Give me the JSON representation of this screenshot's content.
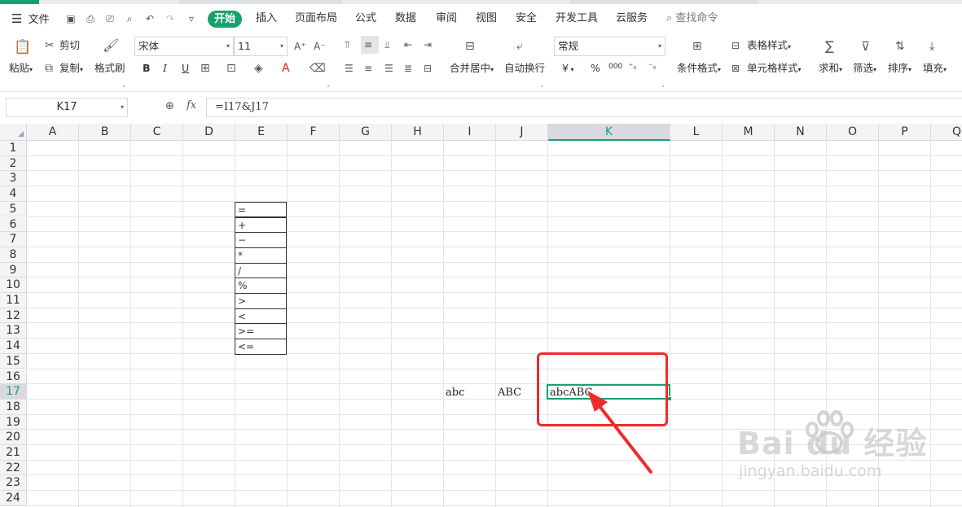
{
  "menu": {
    "file": "文件",
    "tabs": [
      "开始",
      "插入",
      "页面布局",
      "公式",
      "数据",
      "审阅",
      "视图",
      "安全",
      "开发工具",
      "云服务"
    ],
    "active_tab": "开始",
    "search": "查找命令"
  },
  "ribbon": {
    "paste": "粘贴",
    "cut": "剪切",
    "copy": "复制",
    "format_painter": "格式刷",
    "font_name": "宋体",
    "font_size": "11",
    "bold": "B",
    "italic": "I",
    "underline": "U",
    "merge_center": "合并居中",
    "wrap_text": "自动换行",
    "number_format": "常规",
    "currency": "¥",
    "percent": "%",
    "thousands": "000",
    "conditional_format": "条件格式",
    "table_style": "表格样式",
    "cell_style": "单元格样式",
    "sum": "求和",
    "filter": "筛选",
    "sort": "排序",
    "fill": "填充"
  },
  "formula_bar": {
    "name_box": "K17",
    "fx": "fx",
    "formula": "=I17&J17"
  },
  "columns": [
    "A",
    "B",
    "C",
    "D",
    "E",
    "F",
    "G",
    "H",
    "I",
    "J",
    "K",
    "L",
    "M",
    "N",
    "O",
    "P",
    "Q"
  ],
  "rows": [
    "1",
    "2",
    "3",
    "4",
    "5",
    "6",
    "7",
    "8",
    "9",
    "10",
    "11",
    "12",
    "13",
    "14",
    "15",
    "16",
    "17",
    "18",
    "19",
    "20",
    "21",
    "22",
    "23",
    "24"
  ],
  "selected_column": "K",
  "selected_row": "17",
  "operators": [
    "=",
    "+",
    "−",
    "*",
    "/",
    "%",
    ">",
    "<",
    ">=",
    "<="
  ],
  "cells": {
    "I17": "abc",
    "J17": "ABC",
    "K17": "abcABC"
  },
  "watermark": {
    "logo": "Bai du 经验",
    "url": "jingyan.baidu.com"
  },
  "colors": {
    "accent": "#1aa06d",
    "highlight": "#ee2b2b"
  }
}
